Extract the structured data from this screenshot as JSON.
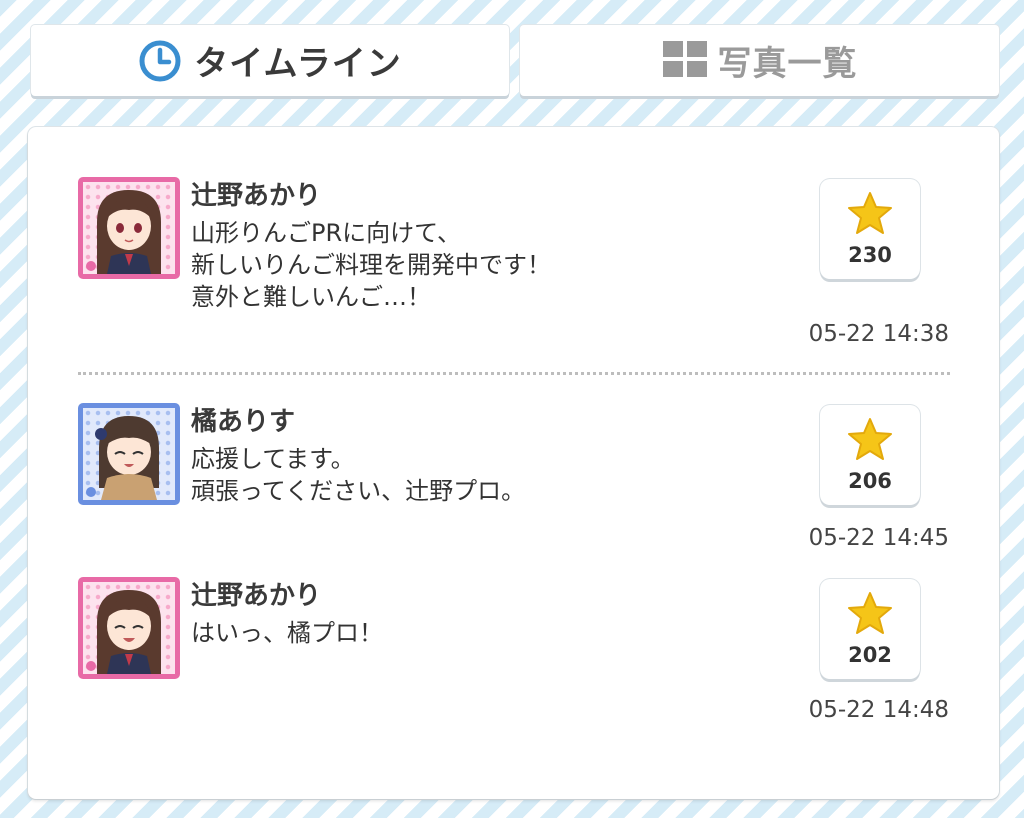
{
  "tabs": [
    {
      "label": "タイムライン",
      "icon": "clock-icon",
      "active": true,
      "color": "#3a8ed0"
    },
    {
      "label": "写真一覧",
      "icon": "grid-icon",
      "active": false,
      "color": "#9a9a9a"
    }
  ],
  "posts": [
    {
      "author": "辻野あかり",
      "avatar_theme": "pink",
      "lines": [
        "山形りんごPRに向けて、",
        "新しいりんご料理を開発中です！",
        "意外と難しいんご…！"
      ],
      "stars": "230",
      "timestamp": "05-22 14:38"
    },
    {
      "author": "橘ありす",
      "avatar_theme": "blue",
      "lines": [
        "応援してます。",
        "頑張ってください、辻野プロ。"
      ],
      "stars": "206",
      "timestamp": "05-22 14:45"
    },
    {
      "author": "辻野あかり",
      "avatar_theme": "pink",
      "lines": [
        "はいっ、橘プロ！"
      ],
      "stars": "202",
      "timestamp": "05-22 14:48"
    }
  ],
  "colors": {
    "accent_blue": "#3a8ed0",
    "star_yellow": "#f5c518",
    "pink_frame": "#e86aa6",
    "blue_frame": "#6a8fe0"
  }
}
